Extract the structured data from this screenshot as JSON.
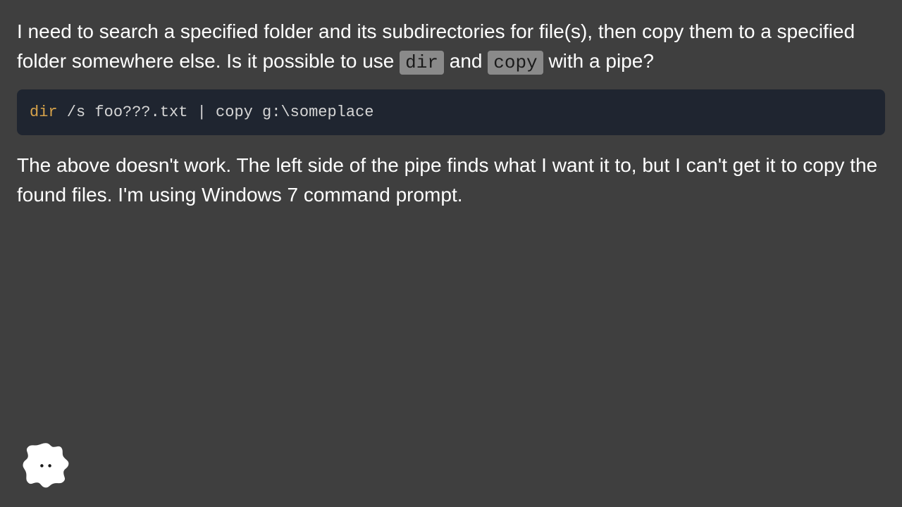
{
  "question": {
    "para1": {
      "pre": "I need to search a specified folder and its subdirectories for file(s), then copy them to a specified folder somewhere else. Is it possible to use ",
      "code1": "dir",
      "mid": " and ",
      "code2": "copy",
      "post": " with a pipe?"
    },
    "code_block": {
      "cmd": "dir",
      "rest": " /s foo???.txt | copy g:\\someplace"
    },
    "para2": "The above doesn't work. The left side of the pipe finds what I want it to, but I can't get it to copy the found files. I'm using Windows 7 command prompt."
  }
}
